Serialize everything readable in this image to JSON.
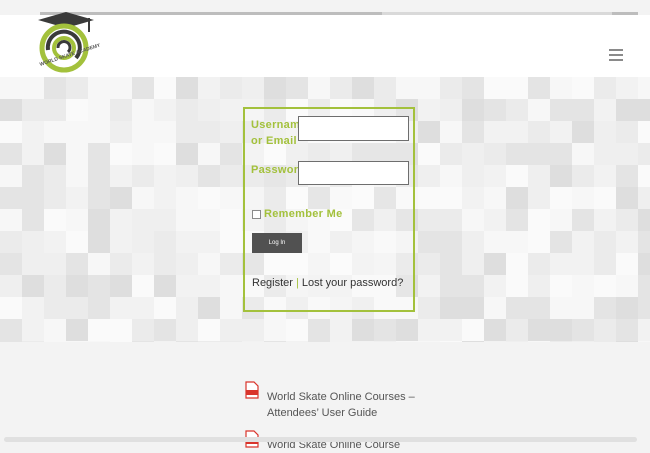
{
  "logo": {
    "wordmark": "WORLD SKATE ACADEMY",
    "colors": {
      "green": "#a3c13c",
      "dark": "#3a3a3a"
    }
  },
  "header": {
    "menu_icon": "hamburger-icon"
  },
  "login": {
    "username_label": "Username or Email",
    "username_value": "",
    "password_label": "Password",
    "password_value": "",
    "remember_label": "Remember Me",
    "remember_checked": false,
    "login_button": "Log In",
    "register_link": "Register",
    "separator": "|",
    "lost_password_link": "Lost your password?"
  },
  "documents": [
    {
      "icon": "pdf-icon",
      "title": "World Skate Online Courses – Attendees’ User Guide"
    },
    {
      "icon": "pdf-icon",
      "title": "World Skate Online Course"
    }
  ],
  "colors": {
    "accent": "#a3c13c",
    "button": "#515151",
    "background": "#f3f3f3"
  }
}
